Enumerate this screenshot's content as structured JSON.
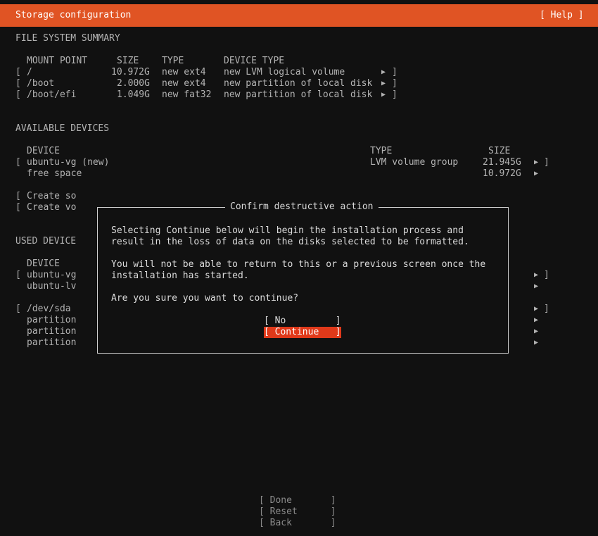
{
  "header": {
    "title": "Storage configuration",
    "help": "[ Help ]"
  },
  "fs_summary": {
    "heading": "FILE SYSTEM SUMMARY",
    "columns": {
      "mount_point": "MOUNT POINT",
      "size": "SIZE",
      "type": "TYPE",
      "device_type": "DEVICE TYPE"
    },
    "rows": [
      {
        "mount": "/",
        "size": "10.972G",
        "type": "new ext4",
        "device_type": "new LVM logical volume"
      },
      {
        "mount": "/boot",
        "size": "2.000G",
        "type": "new ext4",
        "device_type": "new partition of local disk"
      },
      {
        "mount": "/boot/efi",
        "size": "1.049G",
        "type": "new fat32",
        "device_type": "new partition of local disk"
      }
    ]
  },
  "available_devices": {
    "heading": "AVAILABLE DEVICES",
    "columns": {
      "device": "DEVICE",
      "type": "TYPE",
      "size": "SIZE"
    },
    "rows": [
      {
        "device": "ubuntu-vg (new)",
        "type": "LVM volume group",
        "size": "21.945G"
      },
      {
        "device": "free space",
        "type": "",
        "size": "10.972G"
      }
    ],
    "actions": [
      "Create so",
      "Create vo"
    ]
  },
  "used_devices": {
    "heading": "USED DEVICE",
    "column_device": "DEVICE",
    "rows": [
      "ubuntu-vg",
      "ubuntu-lv",
      "/dev/sda",
      "partition",
      "partition",
      "partition"
    ]
  },
  "dialog": {
    "title": "Confirm destructive action",
    "line1": "Selecting Continue below will begin the installation process and",
    "line2": "result in the loss of data on the disks selected to be formatted.",
    "line3": "You will not be able to return to this or a previous screen once the",
    "line4": "installation has started.",
    "question": "Are you sure you want to continue?",
    "no_label": "[ No         ]",
    "continue_label": "[ Continue   ]"
  },
  "footer": {
    "done": "[ Done       ]",
    "reset": "[ Reset      ]",
    "back": "[ Back       ]"
  },
  "glyphs": {
    "arrow": "▶",
    "bracket_open": "[",
    "bracket_close": "]"
  },
  "colors": {
    "header_bg": "#e05424",
    "selected_button_bg": "#e0391a",
    "background": "#111111"
  }
}
